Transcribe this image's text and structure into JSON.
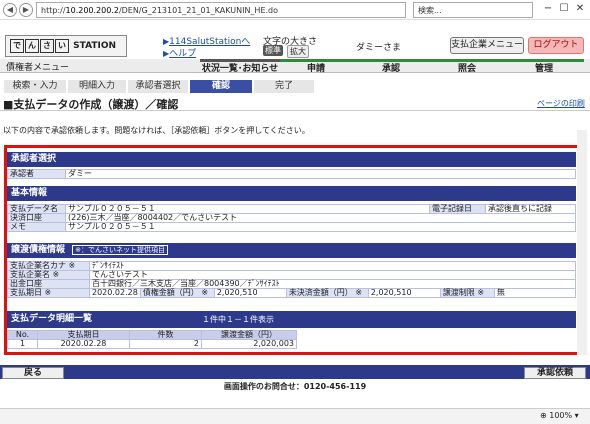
{
  "browser": {
    "url_prefix": "http://",
    "url_host": "10.200.200.2",
    "url_path": "/DEN/G_213101_21_01_KAKUNIN_HE.do",
    "search_placeholder": "検索...",
    "zoom": "100%"
  },
  "header": {
    "logo_chars": [
      "で",
      "ん",
      "さ",
      "い"
    ],
    "logo_text": "STATION",
    "link1": "114SalutStationへ",
    "link2": "ヘルプ",
    "font_size_label": "文字の大きさ",
    "font_std": "標準",
    "font_large": "拡大",
    "user": "ダミーさま",
    "corp_menu": "支払企業メニュー",
    "logout": "ログアウト"
  },
  "menu": {
    "left_label": "債権者メニュー",
    "items": [
      "状況一覧･お知らせ",
      "申請",
      "承認",
      "照会",
      "管理"
    ],
    "colors": [
      "#555555",
      "#2f8a3a",
      "#2f8a3a",
      "#2f8a3a",
      "#2f8a3a"
    ]
  },
  "steps": [
    "検索・入力",
    "明細入力",
    "承認者選択",
    "確認",
    "完了"
  ],
  "page": {
    "title": "■支払データの作成（譲渡）／確認",
    "print": "ページの印刷",
    "notice": "以下の内容で承認依頼します。問題なければ、［承認依頼］ボタンを押してください。"
  },
  "approver": {
    "header": "承認者選択",
    "label": "承認者",
    "value": "ダミー"
  },
  "basic": {
    "header": "基本情報",
    "rows": [
      [
        "支払データ名",
        "サンプル０２０５－５１"
      ],
      [
        "決済口座",
        "(226)三木／当座／8004402／でんさいテスト"
      ],
      [
        "メモ",
        "サンプル０２０５－５１"
      ]
    ],
    "record_label": "電子記録日",
    "record_value": "承認後直ちに記録"
  },
  "transfer": {
    "header": "譲渡債権情報",
    "tag": "※：でんさいネット提供項目",
    "kana_label": "支払企業名カナ",
    "kana_value": "ﾃﾞﾝｻｲﾃｽﾄ",
    "name_label": "支払企業名",
    "name_value": "でんさいテスト",
    "account_label": "出金口座",
    "account_value": "百十四銀行／三木支店／当座／8004390／ﾃﾞﾝｻｲﾃｽﾄ",
    "due_label": "支払期日",
    "due_value": "2020.02.28",
    "amount_label": "債権金額（円）",
    "amount_value": "2,020,510",
    "unsettled_label": "未決済金額（円）",
    "unsettled_value": "2,020,510",
    "restrict_label": "譲渡制限",
    "restrict_value": "無",
    "mark": "※"
  },
  "detail": {
    "header": "支払データ明細一覧",
    "count": "１件中１－１件表示",
    "cols": [
      "No.",
      "支払期日",
      "件数",
      "譲渡金額（円）"
    ],
    "rows": [
      [
        "1",
        "2020.02.28",
        "2",
        "2,020,003"
      ]
    ]
  },
  "footer": {
    "back": "戻る",
    "request": "承認依頼",
    "contact": "画面操作のお問合せ：0120-456-119"
  }
}
